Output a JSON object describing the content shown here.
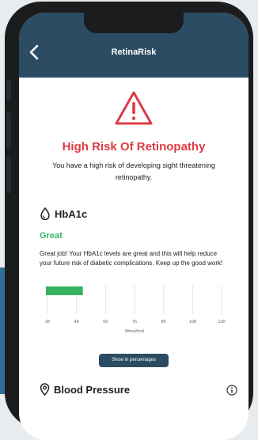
{
  "app": {
    "title": "RetinaRisk"
  },
  "risk": {
    "title": "High Risk Of Retinopathy",
    "description": "You have a high risk of developing sight threatening retinopathy."
  },
  "hba1c": {
    "title": "HbA1c",
    "status": "Great",
    "status_color": "#35b35e",
    "message": "Great job! Your HbA1c levels are great and this will help reduce your future risk of diabetic complications. Keep up the good work!",
    "chart_data": {
      "type": "bar",
      "orientation": "horizontal",
      "categories": [
        "HbA1c"
      ],
      "values": [
        48
      ],
      "x": [
        38,
        48,
        60,
        75,
        86,
        108,
        130
      ],
      "xlabel": "Mmol/mol",
      "xlim": [
        38,
        130
      ],
      "bar_color": "#35b35e"
    },
    "percentages_button": "Show in percentages"
  },
  "blood_pressure": {
    "title": "Blood Pressure"
  },
  "colors": {
    "header": "#2b4c62",
    "alert": "#dc3c45",
    "accent": "#35b35e"
  },
  "icons": {
    "back": "chevron-left-icon",
    "warning": "warning-triangle-icon",
    "hba1c": "drop-icon",
    "blood_pressure": "location-pin-icon",
    "info": "info-icon"
  }
}
